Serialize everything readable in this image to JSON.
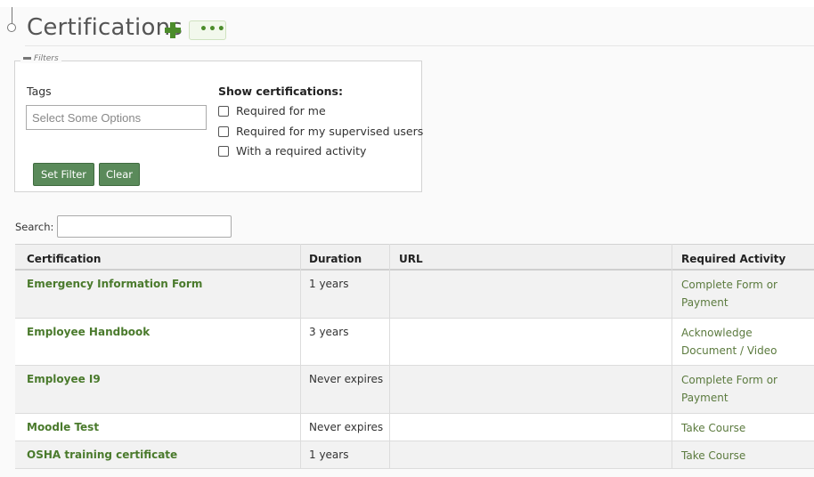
{
  "page": {
    "title": "Certifications"
  },
  "filters": {
    "legend": "Filters",
    "tags_label": "Tags",
    "tags_placeholder": "Select Some Options",
    "show_label": "Show certifications:",
    "options": [
      {
        "label": "Required for me",
        "checked": false
      },
      {
        "label": "Required for my supervised users",
        "checked": false
      },
      {
        "label": "With a required activity",
        "checked": false
      }
    ],
    "set_filter_label": "Set Filter",
    "clear_label": "Clear"
  },
  "search": {
    "label": "Search:",
    "value": ""
  },
  "table": {
    "headers": [
      "Certification",
      "Duration",
      "URL",
      "Required Activity"
    ],
    "rows": [
      {
        "certification": "Emergency Information Form",
        "duration": "1 years",
        "url": "",
        "activity": "Complete Form or Payment"
      },
      {
        "certification": "Employee Handbook",
        "duration": "3 years",
        "url": "",
        "activity": "Acknowledge Document / Video"
      },
      {
        "certification": "Employee I9",
        "duration": "Never expires",
        "url": "",
        "activity": "Complete Form or Payment"
      },
      {
        "certification": "Moodle Test",
        "duration": "Never expires",
        "url": "",
        "activity": "Take Course"
      },
      {
        "certification": "OSHA training certificate",
        "duration": "1 years",
        "url": "",
        "activity": "Take Course"
      }
    ]
  },
  "icons": {
    "add": "plus-icon",
    "more": "ellipsis-icon",
    "timeline": "timeline-node-icon"
  },
  "colors": {
    "accent_green": "#4c8c2b",
    "button_green": "#5a8a5a",
    "link_green": "#4a7a2c"
  }
}
